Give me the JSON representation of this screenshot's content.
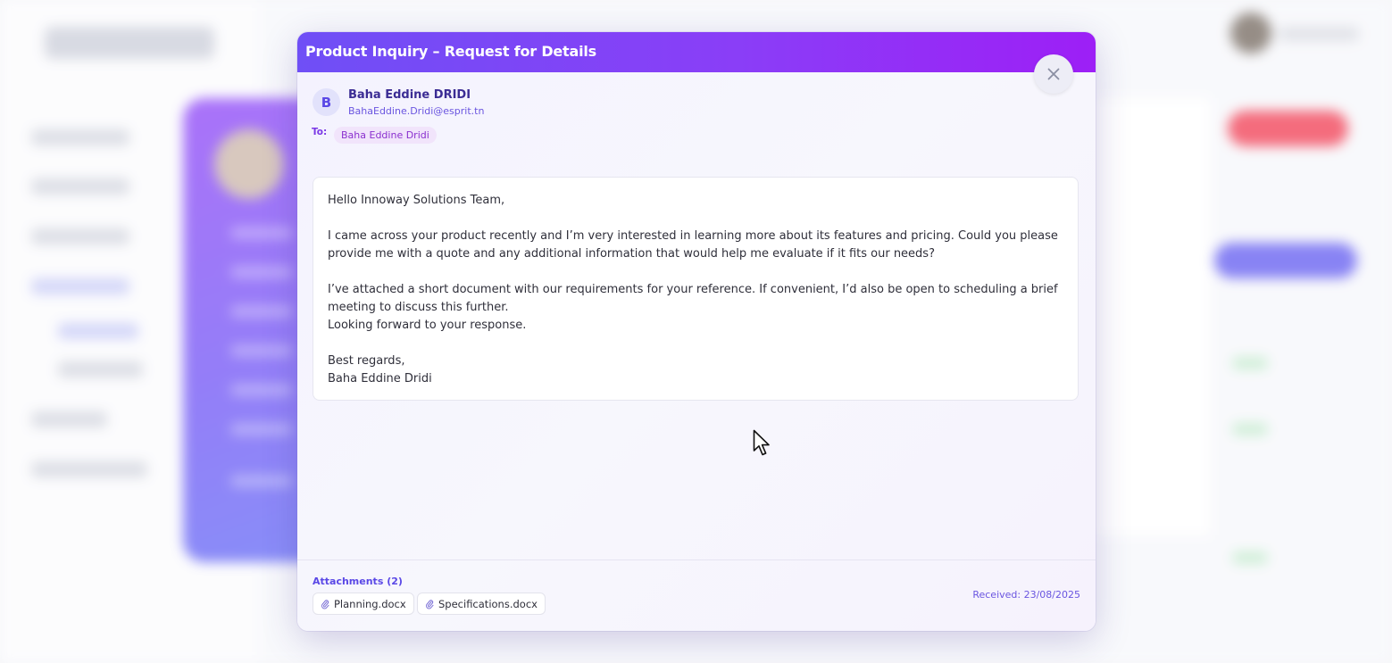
{
  "modal": {
    "title": "Product Inquiry – Request for Details",
    "close_label": "×"
  },
  "sender": {
    "initial": "B",
    "name": "Baha Eddine DRIDI",
    "email": "BahaEddine.Dridi@esprit.tn"
  },
  "recipient": {
    "label": "To:",
    "name": "Baha Eddine Dridi"
  },
  "message": {
    "greeting": "Hello Innoway Solutions Team,",
    "paragraph1": "I came across your product recently and I’m very interested in learning more about its features and pricing. Could you please provide me with a quote and any additional information that would help me evaluate if it fits our needs?",
    "paragraph2": "I’ve attached a short document with our requirements for your reference. If convenient, I’d also be open to scheduling a brief meeting to discuss this further.",
    "paragraph3": "Looking forward to your response.",
    "closing": "Best regards,",
    "signature": "Baha Eddine Dridi"
  },
  "attachments": {
    "label": "Attachments (2)",
    "files": [
      "Planning.docx",
      "Specifications.docx"
    ]
  },
  "received": "Received: 23/08/2025",
  "colors": {
    "header_start": "#6f4ff6",
    "header_end": "#9d1ff6",
    "accent": "#5a48e6",
    "recipient_chip": "#f1e4fb"
  },
  "icons": {
    "close": "close-icon",
    "attachment": "paperclip-icon",
    "cursor": "mouse-pointer-icon"
  }
}
